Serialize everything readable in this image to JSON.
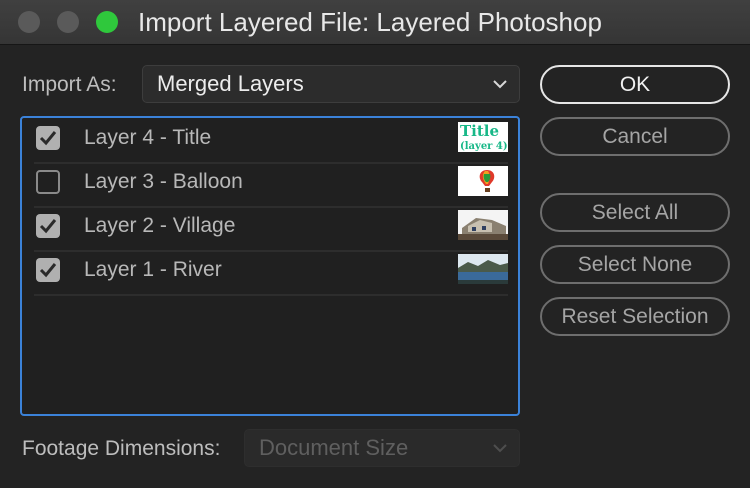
{
  "window": {
    "title": "Import Layered File: Layered Photoshop"
  },
  "import_as": {
    "label": "Import As:",
    "value": "Merged Layers"
  },
  "layers": [
    {
      "label": "Layer 4 - Title",
      "checked": true,
      "thumb_text": [
        "Title",
        "(layer 4)"
      ]
    },
    {
      "label": "Layer 3 - Balloon",
      "checked": false
    },
    {
      "label": "Layer 2 - Village",
      "checked": true
    },
    {
      "label": "Layer 1 - River",
      "checked": true
    }
  ],
  "footage": {
    "label": "Footage Dimensions:",
    "value": "Document Size"
  },
  "buttons": {
    "ok": "OK",
    "cancel": "Cancel",
    "select_all": "Select All",
    "select_none": "Select None",
    "reset_selection": "Reset Selection"
  },
  "colors": {
    "accent_focus": "#3b82d9",
    "zoom_light": "#2fc83c"
  }
}
